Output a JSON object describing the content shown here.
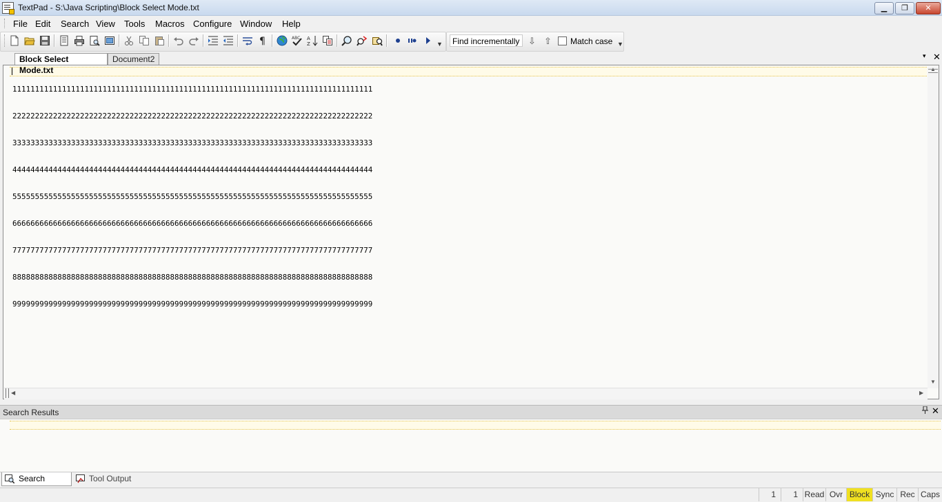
{
  "window": {
    "title": "TextPad - S:\\Java Scripting\\Block Select Mode.txt",
    "minimize_glyph": "▁",
    "restore_glyph": "❐",
    "close_glyph": "✕"
  },
  "menu": [
    "File",
    "Edit",
    "Search",
    "View",
    "Tools",
    "Macros",
    "Configure",
    "Window",
    "Help"
  ],
  "find_bar": {
    "input_value": "Find incrementally",
    "down_glyph": "⇩",
    "up_glyph": "⇧",
    "match_case_label": "Match case",
    "match_case_checked": false
  },
  "tabs": {
    "active": "Block Select Mode.txt",
    "other": "Document2",
    "menu_glyph": "▾",
    "close_glyph": "✕"
  },
  "editor": {
    "lines": [
      "11111111111111111111111111111111111111111111111111111111111111111111111111111111",
      "22222222222222222222222222222222222222222222222222222222222222222222222222222222",
      "33333333333333333333333333333333333333333333333333333333333333333333333333333333",
      "44444444444444444444444444444444444444444444444444444444444444444444444444444444",
      "55555555555555555555555555555555555555555555555555555555555555555555555555555555",
      "66666666666666666666666666666666666666666666666666666666666666666666666666666666",
      "77777777777777777777777777777777777777777777777777777777777777777777777777777777",
      "88888888888888888888888888888888888888888888888888888888888888888888888888888888",
      "99999999999999999999999999999999999999999999999999999999999999999999999999999999"
    ]
  },
  "search_panel": {
    "title": "Search Results",
    "pin_glyph": "📌",
    "close_glyph": "✕"
  },
  "bottom_tabs": [
    "Search Results",
    "Tool Output"
  ],
  "status": {
    "line": "1",
    "column": "1",
    "read": "Read",
    "ovr": "Ovr",
    "block": "Block",
    "sync": "Sync",
    "rec": "Rec",
    "caps": "Caps",
    "block_active_color": "#f0e020"
  }
}
